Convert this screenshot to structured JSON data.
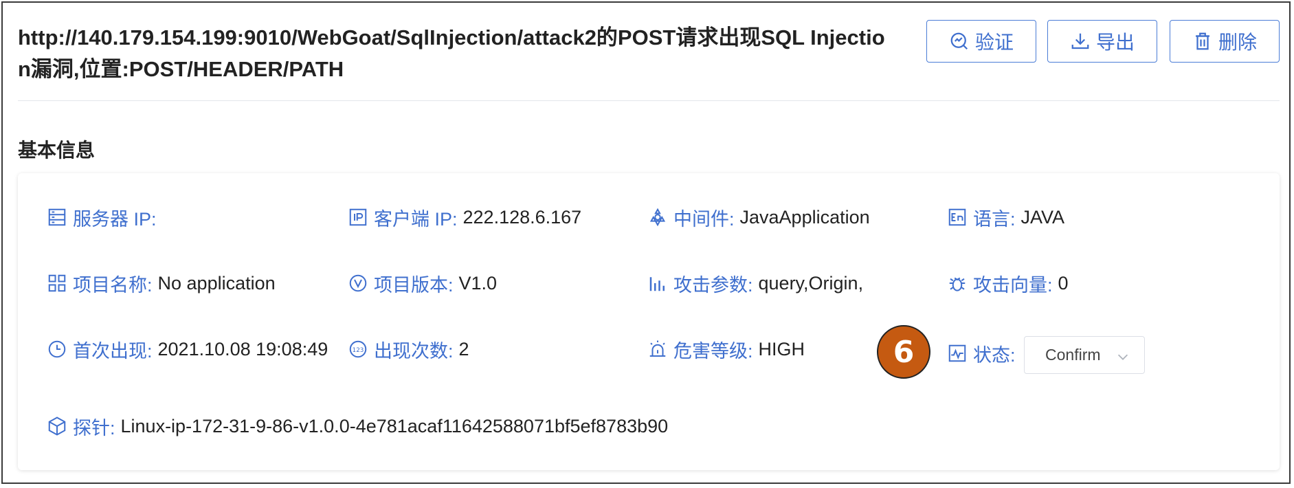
{
  "header": {
    "title": "http://140.179.154.199:9010/WebGoat/SqlInjection/attack2的POST请求出现SQL Injection漏洞,位置:POST/HEADER/PATH"
  },
  "actions": {
    "verify_label": "验证",
    "export_label": "导出",
    "delete_label": "删除"
  },
  "section": {
    "title": "基本信息"
  },
  "fields": {
    "server_ip": {
      "label": "服务器 IP:",
      "value": ""
    },
    "client_ip": {
      "label": "客户端 IP:",
      "value": "222.128.6.167"
    },
    "middleware": {
      "label": "中间件:",
      "value": "JavaApplication"
    },
    "language": {
      "label": "语言:",
      "value": "JAVA"
    },
    "project_name": {
      "label": "项目名称:",
      "value": "No application"
    },
    "project_version": {
      "label": "项目版本:",
      "value": "V1.0"
    },
    "attack_params": {
      "label": "攻击参数:",
      "value": "query,Origin,"
    },
    "attack_vector": {
      "label": "攻击向量:",
      "value": "0"
    },
    "first_seen": {
      "label": "首次出现:",
      "value": "2021.10.08 19:08:49"
    },
    "occurrences": {
      "label": "出现次数:",
      "value": "2"
    },
    "severity": {
      "label": "危害等级:",
      "value": "HIGH"
    },
    "status": {
      "label": "状态:",
      "value": "Confirm"
    },
    "probe": {
      "label": "探针:",
      "value": "Linux-ip-172-31-9-86-v1.0.0-4e781acaf11642588071bf5ef8783b90"
    }
  },
  "annotation": {
    "number": "6"
  },
  "colors": {
    "accent": "#3f6fce",
    "badge": "#c55a11",
    "text": "#222222"
  },
  "icons": [
    "verify-icon",
    "download-icon",
    "trash-icon",
    "server-icon",
    "ip-icon",
    "middleware-icon",
    "language-icon",
    "grid-icon",
    "version-icon",
    "bar-chart-icon",
    "bug-icon",
    "clock-icon",
    "counter-icon",
    "alarm-icon",
    "status-icon",
    "probe-icon",
    "chevron-down-icon"
  ]
}
